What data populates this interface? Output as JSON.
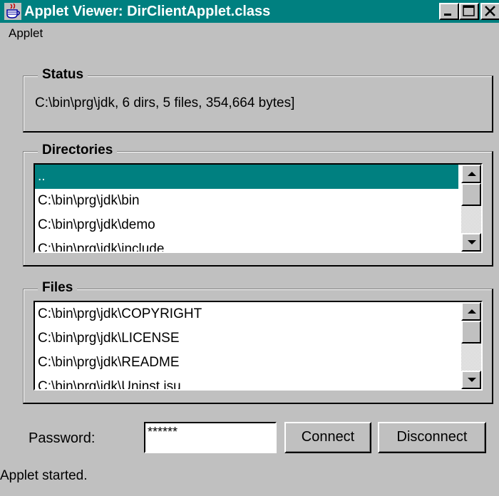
{
  "window": {
    "title": "Applet Viewer: DirClientApplet.class",
    "accent_color": "#008080"
  },
  "menu": {
    "items": [
      "Applet"
    ]
  },
  "status": {
    "label": "Status",
    "text": "C:\\bin\\prg\\jdk, 6 dirs, 5 files, 354,664 bytes]"
  },
  "directories": {
    "label": "Directories",
    "items": [
      "..",
      "C:\\bin\\prg\\jdk\\bin",
      "C:\\bin\\prg\\jdk\\demo",
      "C:\\bin\\prg\\jdk\\include"
    ],
    "selected_index": 0
  },
  "files": {
    "label": "Files",
    "items": [
      "C:\\bin\\prg\\jdk\\COPYRIGHT",
      "C:\\bin\\prg\\jdk\\LICENSE",
      "C:\\bin\\prg\\jdk\\README",
      "C:\\bin\\prg\\jdk\\Uninst.isu"
    ]
  },
  "login": {
    "password_label": "Password:",
    "password_value": "******",
    "connect_label": "Connect",
    "disconnect_label": "Disconnect"
  },
  "statusbar": {
    "text": "Applet started."
  },
  "icons": {
    "app": "java-cup-icon",
    "minimize": "minimize-icon",
    "maximize": "maximize-icon",
    "close": "close-icon",
    "scroll_up": "arrow-up-icon",
    "scroll_down": "arrow-down-icon"
  }
}
